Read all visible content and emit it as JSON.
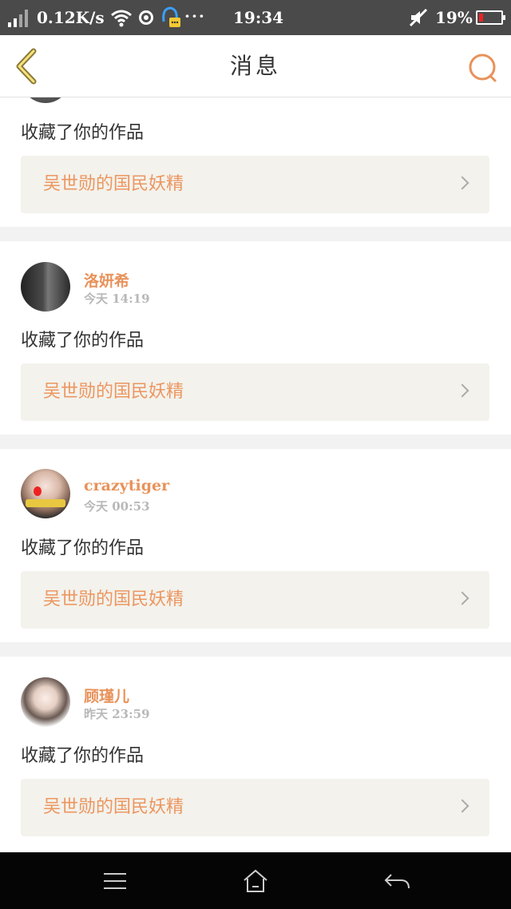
{
  "status_bar": {
    "net_speed": "0.12K/s",
    "dots": "···",
    "time": "19:34",
    "battery": "19%",
    "icons": [
      "signal-icon",
      "wifi-icon",
      "location-icon",
      "qq-notification-icon",
      "mute-icon",
      "battery-icon"
    ]
  },
  "nav": {
    "title": "消息",
    "back_icon": "chevron-left-icon",
    "search_icon": "search-icon",
    "accent": "#e8925a"
  },
  "notifications": [
    {
      "user": "",
      "time": "",
      "action": "收藏了你的作品",
      "work": "吴世勋的国民妖精"
    },
    {
      "user": "洛妍希",
      "time": "今天 14:19",
      "action": "收藏了你的作品",
      "work": "吴世勋的国民妖精"
    },
    {
      "user": "crazytiger",
      "time": "今天 00:53",
      "action": "收藏了你的作品",
      "work": "吴世勋的国民妖精"
    },
    {
      "user": "顾瑾儿",
      "time": "昨天 23:59",
      "action": "收藏了你的作品",
      "work": "吴世勋的国民妖精"
    }
  ],
  "system_nav": {
    "icons": [
      "menu-icon",
      "home-icon",
      "back-icon"
    ]
  }
}
